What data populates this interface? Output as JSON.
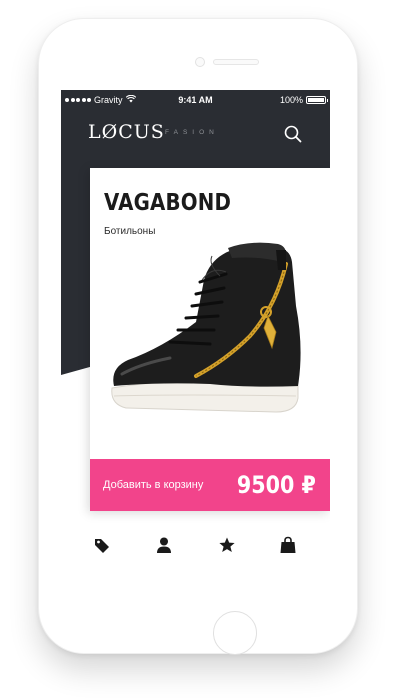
{
  "status_bar": {
    "carrier": "Gravity",
    "time": "9:41 AM",
    "battery": "100%"
  },
  "header": {
    "logo": "LØCUS",
    "subtitle": "FASION",
    "search_icon": "search-icon"
  },
  "product": {
    "name": "VAGABOND",
    "category": "Ботильоны",
    "image": "black-high-top-sneaker-with-gold-zipper",
    "add_to_cart_label": "Добавить в корзину",
    "price": "9500 ₽"
  },
  "tabs": [
    {
      "icon": "tag-icon"
    },
    {
      "icon": "user-icon"
    },
    {
      "icon": "star-icon"
    },
    {
      "icon": "shopping-bag-icon"
    }
  ],
  "colors": {
    "dark": "#2a2d33",
    "accent": "#f2448b",
    "text": "#1b1b1b"
  }
}
